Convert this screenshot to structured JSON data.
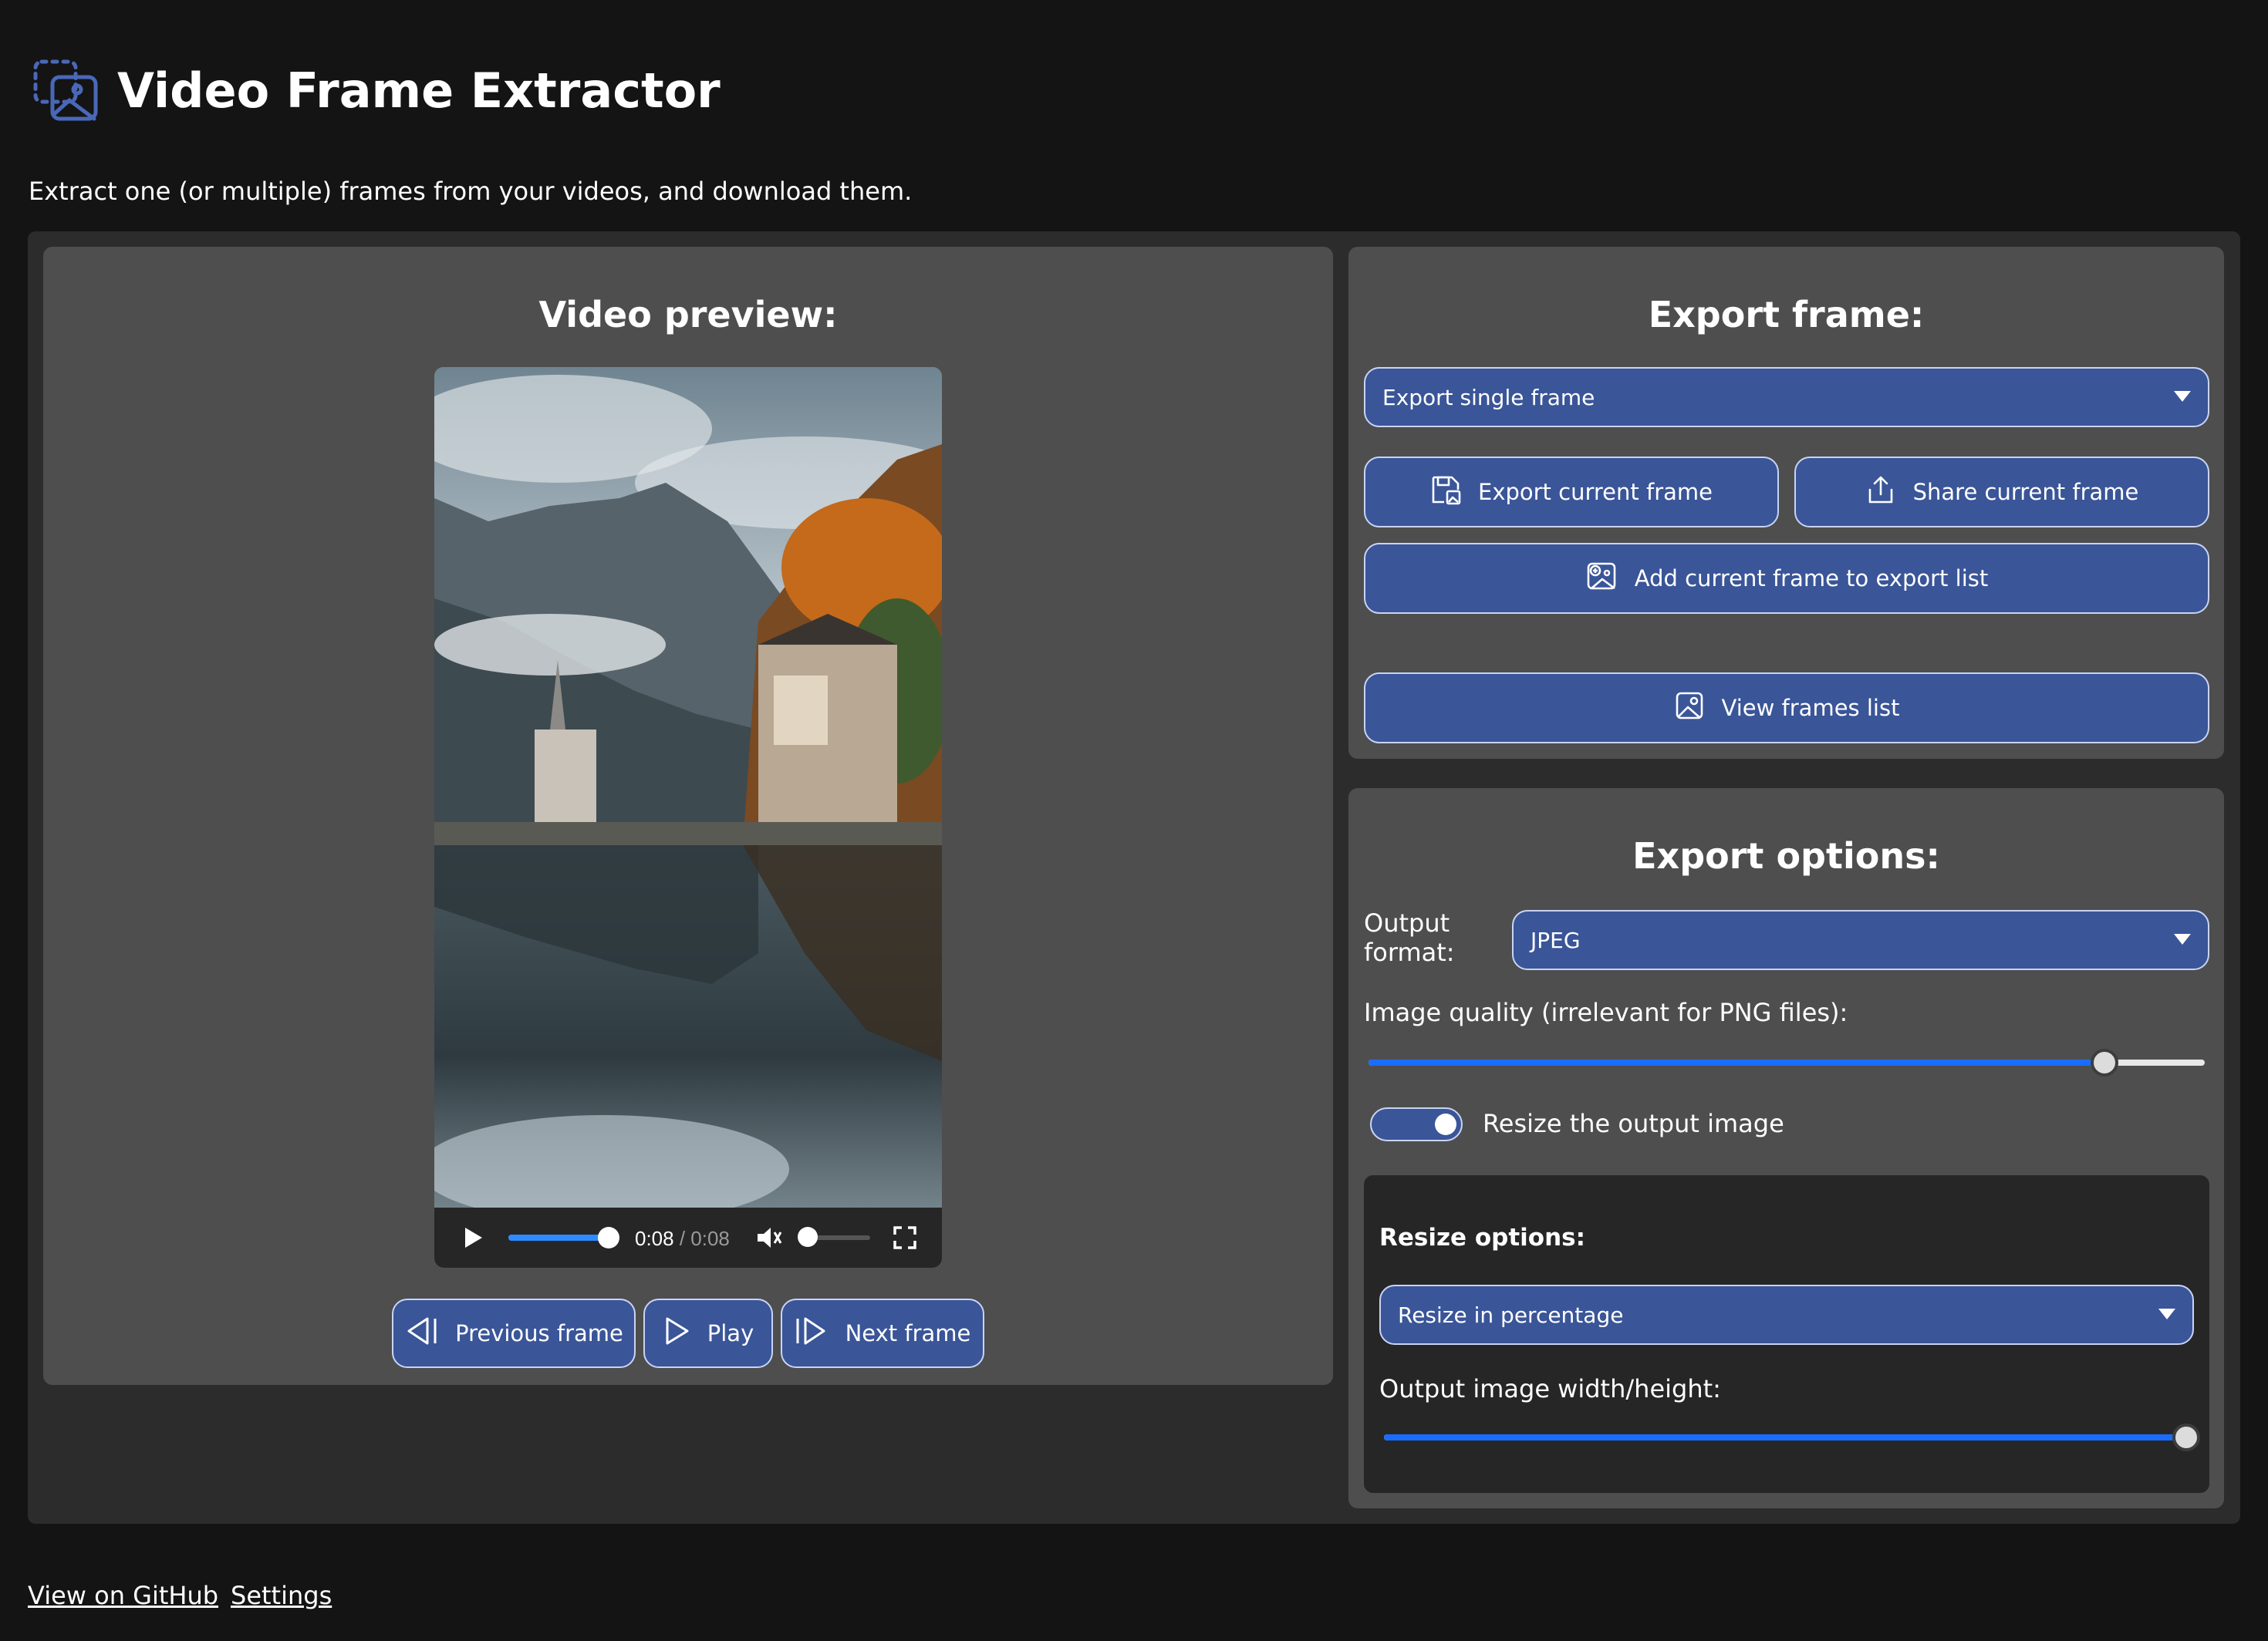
{
  "header": {
    "title": "Video Frame Extractor",
    "subtitle": "Extract one (or multiple) frames from your videos, and download them."
  },
  "video_panel": {
    "title": "Video preview:",
    "player": {
      "current_time": "0:08",
      "separator": " / ",
      "duration": "0:08",
      "progress_fraction": 1.0,
      "muted": true,
      "volume_fraction": 0.0
    },
    "buttons": {
      "previous_label": "Previous frame",
      "play_label": "Play",
      "next_label": "Next frame"
    }
  },
  "export_panel": {
    "title": "Export frame:",
    "mode_select": {
      "selected": "Export single frame"
    },
    "export_current_label": "Export current frame",
    "share_current_label": "Share current frame",
    "add_to_list_label": "Add current frame to export list",
    "view_list_label": "View frames list"
  },
  "options_panel": {
    "title": "Export options:",
    "output_format_label": "Output\nformat:",
    "output_format_selected": "JPEG",
    "quality_label": "Image quality (irrelevant for PNG files):",
    "quality_fraction": 0.88,
    "resize_toggle_label": "Resize the output image",
    "resize_toggle_on": true,
    "resize": {
      "title": "Resize options:",
      "mode_selected": "Resize in percentage",
      "size_label": "Output image width/height:",
      "size_fraction": 1.0
    }
  },
  "footer": {
    "github_label": "View on GitHub",
    "settings_label": "Settings"
  },
  "colors": {
    "background": "#141414",
    "panel": "#4e4e4e",
    "button": "#3a5598",
    "button_border": "#c9d4f4",
    "slider_fill": "#1a6cff"
  },
  "icons": [
    "app-logo-icon",
    "play-icon",
    "volume-muted-icon",
    "fullscreen-icon",
    "previous-frame-icon",
    "next-frame-icon",
    "save-image-icon",
    "share-icon",
    "add-image-icon",
    "image-icon",
    "chevron-down-icon"
  ]
}
